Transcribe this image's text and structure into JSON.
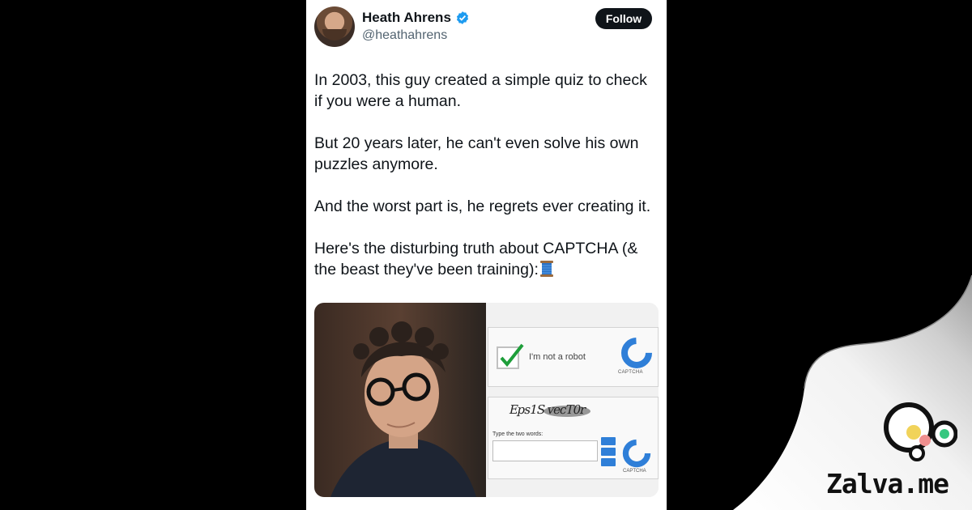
{
  "tweet": {
    "display_name": "Heath Ahrens",
    "handle": "@heathahrens",
    "follow_label": "Follow",
    "verified_icon": "verified-badge-icon",
    "paragraphs": [
      "In 2003, this guy created a simple quiz to check\nif you were a human.",
      "But 20 years later, he can't even solve his own\npuzzles anymore.",
      "And the worst part is, he regrets ever creating it."
    ],
    "last_paragraph": "Here's the disturbing truth about CAPTCHA (&\nthe beast they've been training):",
    "thread_icon": "spool-of-thread-icon"
  },
  "media": {
    "recaptcha_label": "I'm not a robot",
    "recaptcha_brand": "CAPTCHA",
    "distorted_text": "Eps1S  vecT0r",
    "type_label": "Type the two words:",
    "captcha_brand_2": "CAPTCHA"
  },
  "watermark": {
    "brand_name": "Zalva.me"
  },
  "colors": {
    "follow_bg": "#0f1419",
    "verified": "#1d9bf0",
    "captcha_blue": "#2f7fd8"
  }
}
